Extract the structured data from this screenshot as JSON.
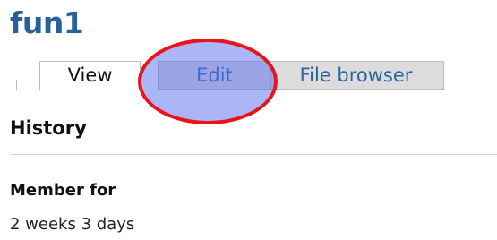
{
  "page": {
    "title": "fun1"
  },
  "tabs": [
    {
      "label": "View",
      "active": true
    },
    {
      "label": "Edit",
      "active": false,
      "highlighted": true
    },
    {
      "label": "File browser",
      "active": false
    }
  ],
  "history": {
    "heading": "History",
    "member_for_label": "Member for",
    "member_for_value": "2 weeks 3 days"
  },
  "colors": {
    "title": "#27609a",
    "link": "#2a62a4",
    "inactive_tab_bg": "#dcdcdc",
    "highlight_outline": "#e8131b",
    "highlight_fill": "#5a6ef0"
  }
}
